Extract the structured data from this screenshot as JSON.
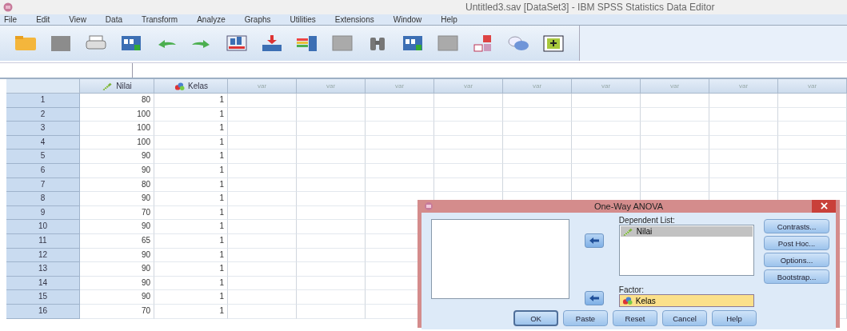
{
  "window": {
    "title": "Untitled3.sav [DataSet3] - IBM SPSS Statistics Data Editor"
  },
  "menu": [
    "File",
    "Edit",
    "View",
    "Data",
    "Transform",
    "Analyze",
    "Graphs",
    "Utilities",
    "Extensions",
    "Window",
    "Help"
  ],
  "toolbar": [
    {
      "kind": "folder"
    },
    {
      "kind": "disk"
    },
    {
      "kind": "printer"
    },
    {
      "kind": "grid"
    },
    {
      "kind": "undo"
    },
    {
      "kind": "redo"
    },
    {
      "kind": "chart"
    },
    {
      "kind": "insert"
    },
    {
      "kind": "bars"
    },
    {
      "kind": "table"
    },
    {
      "kind": "binoculars"
    },
    {
      "kind": "grid"
    },
    {
      "kind": "table"
    },
    {
      "kind": "label"
    },
    {
      "kind": "circles"
    },
    {
      "kind": "add"
    }
  ],
  "table": {
    "columns": [
      {
        "label": "Nilai",
        "kind": "scale"
      },
      {
        "label": "Kelas",
        "kind": "nominal"
      },
      {
        "label": "var",
        "kind": "empty"
      },
      {
        "label": "var",
        "kind": "empty"
      },
      {
        "label": "var",
        "kind": "empty"
      },
      {
        "label": "var",
        "kind": "empty"
      },
      {
        "label": "var",
        "kind": "empty"
      },
      {
        "label": "var",
        "kind": "empty"
      },
      {
        "label": "var",
        "kind": "empty"
      },
      {
        "label": "var",
        "kind": "empty"
      },
      {
        "label": "var",
        "kind": "empty"
      }
    ],
    "rows": [
      {
        "n": "1",
        "cells": [
          "80",
          "1"
        ]
      },
      {
        "n": "2",
        "cells": [
          "100",
          "1"
        ]
      },
      {
        "n": "3",
        "cells": [
          "100",
          "1"
        ]
      },
      {
        "n": "4",
        "cells": [
          "100",
          "1"
        ]
      },
      {
        "n": "5",
        "cells": [
          "90",
          "1"
        ]
      },
      {
        "n": "6",
        "cells": [
          "90",
          "1"
        ]
      },
      {
        "n": "7",
        "cells": [
          "80",
          "1"
        ]
      },
      {
        "n": "8",
        "cells": [
          "90",
          "1"
        ]
      },
      {
        "n": "9",
        "cells": [
          "70",
          "1"
        ]
      },
      {
        "n": "10",
        "cells": [
          "90",
          "1"
        ]
      },
      {
        "n": "11",
        "cells": [
          "65",
          "1"
        ]
      },
      {
        "n": "12",
        "cells": [
          "90",
          "1"
        ]
      },
      {
        "n": "13",
        "cells": [
          "90",
          "1"
        ]
      },
      {
        "n": "14",
        "cells": [
          "90",
          "1"
        ]
      },
      {
        "n": "15",
        "cells": [
          "90",
          "1"
        ]
      },
      {
        "n": "16",
        "cells": [
          "70",
          "1"
        ]
      }
    ]
  },
  "dialog": {
    "title": "One-Way ANOVA",
    "dependent_label": "Dependent List:",
    "dependent_items": [
      {
        "label": "Nilai",
        "kind": "scale",
        "selected": true
      }
    ],
    "factor_label": "Factor:",
    "factor": {
      "label": "Kelas",
      "kind": "nominal"
    },
    "side_buttons": [
      "Contrasts...",
      "Post Hoc...",
      "Options...",
      "Bootstrap..."
    ],
    "buttons": [
      {
        "label": "OK",
        "default": true
      },
      {
        "label": "Paste",
        "default": false
      },
      {
        "label": "Reset",
        "default": false
      },
      {
        "label": "Cancel",
        "default": false
      },
      {
        "label": "Help",
        "default": false
      }
    ]
  }
}
